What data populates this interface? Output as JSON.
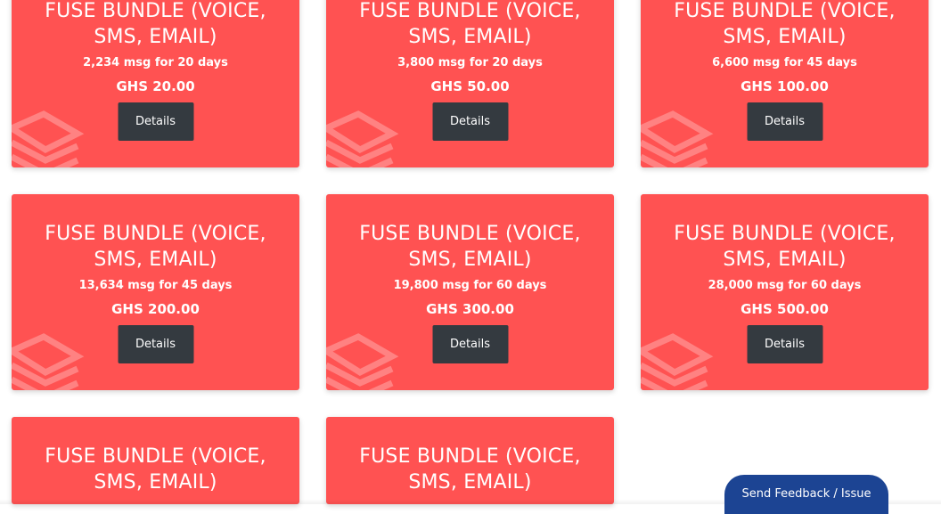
{
  "colors": {
    "card_bg": "#ff5252",
    "button_bg": "#343a40",
    "feedback_bg": "#1c4493"
  },
  "cards": [
    {
      "title": "FUSE BUNDLE (VOICE, SMS, EMAIL)",
      "messages": "2,234 msg for 20 days",
      "price": "GHS 20.00",
      "button": "Details"
    },
    {
      "title": "FUSE BUNDLE (VOICE, SMS, EMAIL)",
      "messages": "3,800 msg for 20 days",
      "price": "GHS 50.00",
      "button": "Details"
    },
    {
      "title": "FUSE BUNDLE (VOICE, SMS, EMAIL)",
      "messages": "6,600 msg for 45 days",
      "price": "GHS 100.00",
      "button": "Details"
    },
    {
      "title": "FUSE BUNDLE (VOICE, SMS, EMAIL)",
      "messages": "13,634 msg for 45 days",
      "price": "GHS 200.00",
      "button": "Details"
    },
    {
      "title": "FUSE BUNDLE (VOICE, SMS, EMAIL)",
      "messages": "19,800 msg for 60 days",
      "price": "GHS 300.00",
      "button": "Details"
    },
    {
      "title": "FUSE BUNDLE (VOICE, SMS, EMAIL)",
      "messages": "28,000 msg for 60 days",
      "price": "GHS 500.00",
      "button": "Details"
    },
    {
      "title": "FUSE BUNDLE (VOICE, SMS, EMAIL)"
    },
    {
      "title": "FUSE BUNDLE (VOICE, SMS, EMAIL)"
    }
  ],
  "feedback_button": "Send Feedback / Issue"
}
